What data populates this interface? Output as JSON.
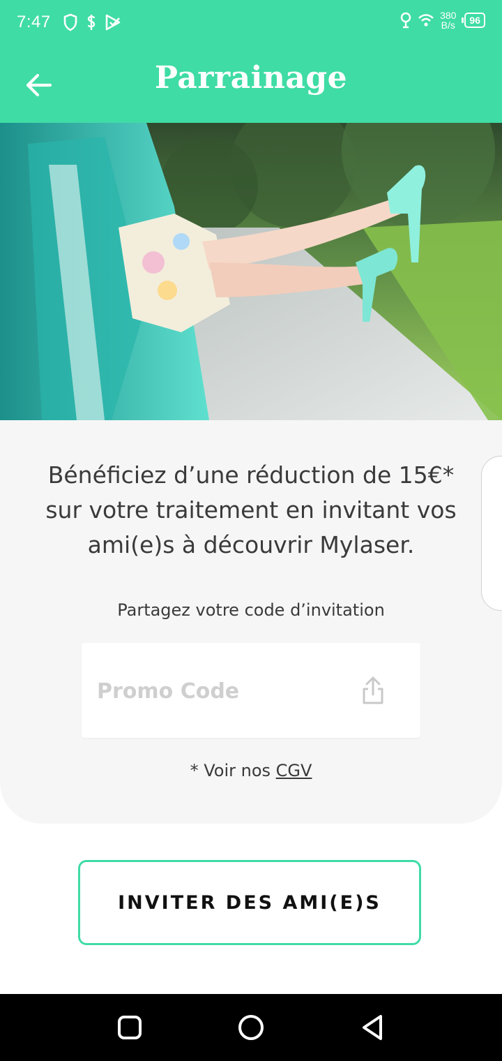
{
  "status_bar": {
    "time": "7:47",
    "net_speed_value": "380",
    "net_speed_unit": "B/s",
    "battery": "96"
  },
  "app_bar": {
    "title": "Parrainage",
    "back_icon": "arrow-left-icon"
  },
  "content": {
    "headline": "Bénéficiez d’une réduction de 15€* sur votre traitement en invitant vos ami(e)s à découvrir Mylaser.",
    "share_label": "Partagez votre code d’invitation",
    "promo_placeholder": "Promo Code",
    "cgv_prefix": "* Voir nos ",
    "cgv_link": "CGV",
    "share_icon": "share-icon"
  },
  "cta": {
    "label": "INVITER DES AMI(E)S"
  },
  "colors": {
    "accent": "#3fdca5",
    "card_bg": "#f6f6f6",
    "text": "#3a3a3a"
  }
}
